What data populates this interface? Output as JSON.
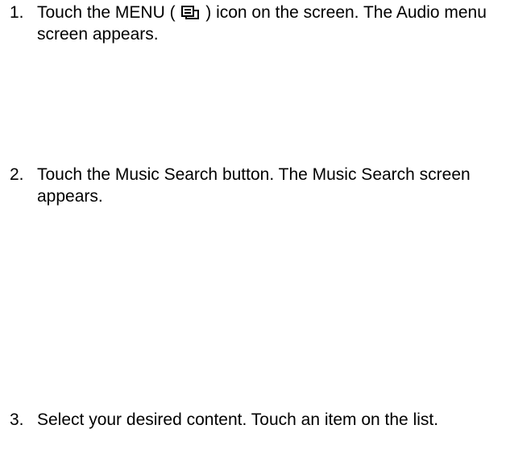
{
  "steps": [
    {
      "number": "1.",
      "before_icon": "Touch the MENU ( ",
      "icon": "menu-icon",
      "after_icon": " ) icon on the screen. The Audio menu screen appears."
    },
    {
      "number": "2.",
      "text": "Touch the Music Search button. The Music Search screen appears."
    },
    {
      "number": "3.",
      "text": "Select your desired content. Touch an item on the list."
    }
  ]
}
